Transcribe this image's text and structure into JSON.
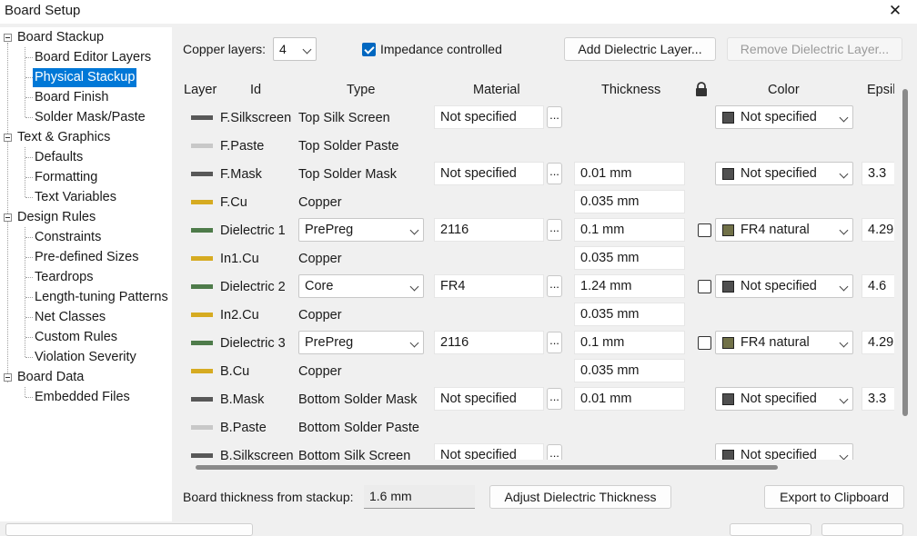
{
  "window": {
    "title": "Board Setup"
  },
  "tree": {
    "items": [
      {
        "label": "Board Stackup",
        "level": 0
      },
      {
        "label": "Board Editor Layers",
        "level": 1
      },
      {
        "label": "Physical Stackup",
        "level": 1,
        "selected": true
      },
      {
        "label": "Board Finish",
        "level": 1
      },
      {
        "label": "Solder Mask/Paste",
        "level": 1
      },
      {
        "label": "Text & Graphics",
        "level": 0
      },
      {
        "label": "Defaults",
        "level": 1
      },
      {
        "label": "Formatting",
        "level": 1
      },
      {
        "label": "Text Variables",
        "level": 1
      },
      {
        "label": "Design Rules",
        "level": 0
      },
      {
        "label": "Constraints",
        "level": 1
      },
      {
        "label": "Pre-defined Sizes",
        "level": 1
      },
      {
        "label": "Teardrops",
        "level": 1
      },
      {
        "label": "Length-tuning Patterns",
        "level": 1
      },
      {
        "label": "Net Classes",
        "level": 1
      },
      {
        "label": "Custom Rules",
        "level": 1
      },
      {
        "label": "Violation Severity",
        "level": 1
      },
      {
        "label": "Board Data",
        "level": 0
      },
      {
        "label": "Embedded Files",
        "level": 1
      }
    ]
  },
  "toolbar": {
    "copper_layers_label": "Copper layers:",
    "copper_layers_value": "4",
    "impedance_label": "Impedance controlled",
    "impedance_checked": true,
    "add_dielectric_label": "Add Dielectric Layer...",
    "remove_dielectric_label": "Remove Dielectric Layer..."
  },
  "columns": {
    "layer": "Layer",
    "id": "Id",
    "type": "Type",
    "material": "Material",
    "thickness": "Thickness",
    "color": "Color",
    "epsilon": "Epsil"
  },
  "colors": {
    "silk": "#585858",
    "paste": "#c8c8c8",
    "mask": "#585858",
    "copper": "#d6ab21",
    "dielectric": "#4e7b4a",
    "fr4": "#717148",
    "not_specified_swatch": "#4f4f4f"
  },
  "rows": [
    {
      "swatch": "#585858",
      "id": "F.Silkscreen",
      "type": "Top Silk Screen",
      "material": "Not specified",
      "thickness": "",
      "color": "Not specified",
      "color_swatch": "#4f4f4f",
      "epsilon": "",
      "locked": false
    },
    {
      "swatch": "#c8c8c8",
      "id": "F.Paste",
      "type": "Top Solder Paste",
      "material": "",
      "thickness": "",
      "color": "",
      "color_swatch": "",
      "epsilon": "",
      "locked": false
    },
    {
      "swatch": "#585858",
      "id": "F.Mask",
      "type": "Top Solder Mask",
      "material": "Not specified",
      "thickness": "0.01 mm",
      "color": "Not specified",
      "color_swatch": "#4f4f4f",
      "epsilon": "3.3",
      "locked": false
    },
    {
      "swatch": "#d6ab21",
      "id": "F.Cu",
      "type": "Copper",
      "material": "",
      "thickness": "0.035 mm",
      "color": "",
      "color_swatch": "",
      "epsilon": "",
      "locked": false
    },
    {
      "swatch": "#4e7b4a",
      "id": "Dielectric 1",
      "type": "PrePreg",
      "type_combo": true,
      "material": "2116",
      "thickness": "0.1 mm",
      "has_lock": true,
      "color": "FR4 natural",
      "color_swatch": "#717148",
      "epsilon": "4.29"
    },
    {
      "swatch": "#d6ab21",
      "id": "In1.Cu",
      "type": "Copper",
      "material": "",
      "thickness": "0.035 mm",
      "color": "",
      "color_swatch": "",
      "epsilon": ""
    },
    {
      "swatch": "#4e7b4a",
      "id": "Dielectric 2",
      "type": "Core",
      "type_combo": true,
      "material": "FR4",
      "thickness": "1.24 mm",
      "has_lock": true,
      "color": "Not specified",
      "color_swatch": "#4f4f4f",
      "epsilon": "4.6"
    },
    {
      "swatch": "#d6ab21",
      "id": "In2.Cu",
      "type": "Copper",
      "material": "",
      "thickness": "0.035 mm",
      "color": "",
      "color_swatch": "",
      "epsilon": ""
    },
    {
      "swatch": "#4e7b4a",
      "id": "Dielectric 3",
      "type": "PrePreg",
      "type_combo": true,
      "material": "2116",
      "thickness": "0.1 mm",
      "has_lock": true,
      "color": "FR4 natural",
      "color_swatch": "#717148",
      "epsilon": "4.29"
    },
    {
      "swatch": "#d6ab21",
      "id": "B.Cu",
      "type": "Copper",
      "material": "",
      "thickness": "0.035 mm",
      "color": "",
      "color_swatch": "",
      "epsilon": ""
    },
    {
      "swatch": "#585858",
      "id": "B.Mask",
      "type": "Bottom Solder Mask",
      "material": "Not specified",
      "thickness": "0.01 mm",
      "color": "Not specified",
      "color_swatch": "#4f4f4f",
      "epsilon": "3.3"
    },
    {
      "swatch": "#c8c8c8",
      "id": "B.Paste",
      "type": "Bottom Solder Paste",
      "material": "",
      "thickness": "",
      "color": "",
      "color_swatch": "",
      "epsilon": ""
    },
    {
      "swatch": "#585858",
      "id": "B.Silkscreen",
      "type": "Bottom Silk Screen",
      "material": "Not specified",
      "thickness": "",
      "color": "Not specified",
      "color_swatch": "#4f4f4f",
      "epsilon": ""
    }
  ],
  "footer": {
    "board_thickness_label": "Board thickness from stackup:",
    "board_thickness_value": "1.6 mm",
    "adjust_label": "Adjust Dielectric Thickness",
    "export_label": "Export to Clipboard"
  }
}
